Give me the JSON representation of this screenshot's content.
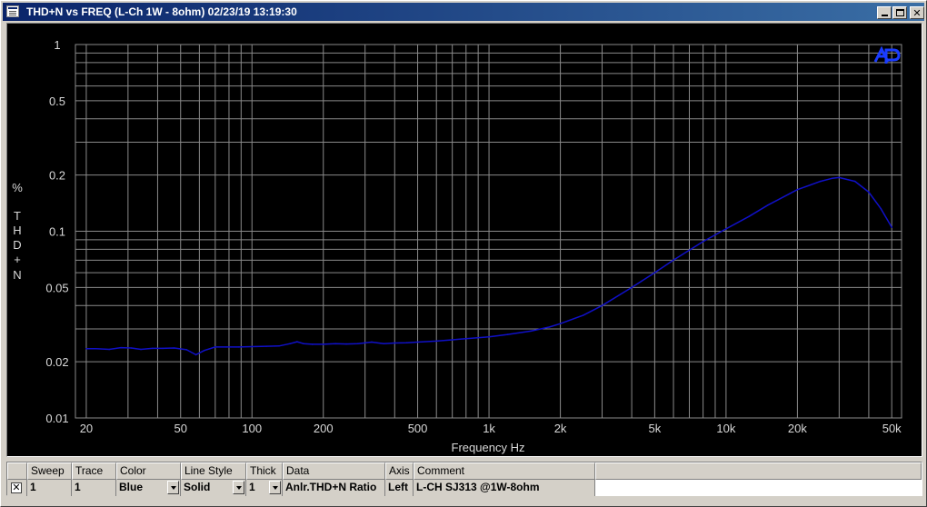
{
  "window": {
    "title": "THD+N vs FREQ (L-Ch 1W - 8ohm)  02/23/19 13:19:30"
  },
  "icons": {
    "app": "window-icon",
    "minimize": "minimize-icon",
    "maximize": "maximize-icon",
    "close": "close-icon",
    "logo": "ap-logo"
  },
  "colors": {
    "trace": "#1010c8",
    "grid": "#8a8a8a",
    "axis_text": "#d8d8d8",
    "logo": "#1a3cff"
  },
  "chart_data": {
    "type": "line",
    "title": "",
    "xlabel": "Frequency Hz",
    "ylabel": "% THD+N",
    "xscale": "log",
    "yscale": "log",
    "xlim": [
      18,
      55000
    ],
    "ylim": [
      0.01,
      1
    ],
    "grid": true,
    "x_ticks": [
      20,
      50,
      100,
      200,
      500,
      1000,
      2000,
      5000,
      10000,
      20000,
      50000
    ],
    "x_tick_labels": [
      "20",
      "50",
      "100",
      "200",
      "500",
      "1k",
      "2k",
      "5k",
      "10k",
      "20k",
      "50k"
    ],
    "y_ticks": [
      0.01,
      0.02,
      0.05,
      0.1,
      0.2,
      0.5,
      1
    ],
    "y_tick_labels": [
      "0.01",
      "0.02",
      "0.05",
      "0.1",
      "0.2",
      "0.5",
      "1"
    ],
    "series": [
      {
        "name": "L-CH SJ313 @1W-8ohm",
        "color": "Blue",
        "x": [
          20,
          22,
          25,
          28,
          31,
          34,
          38,
          42,
          47,
          53,
          58,
          63,
          70,
          78,
          88,
          100,
          115,
          130,
          145,
          155,
          165,
          180,
          200,
          225,
          250,
          280,
          320,
          360,
          400,
          450,
          500,
          600,
          700,
          800,
          1000,
          1200,
          1500,
          1800,
          2000,
          2500,
          3000,
          4000,
          5000,
          6000,
          8000,
          10000,
          12500,
          15000,
          20000,
          25000,
          28000,
          30000,
          35000,
          40000,
          45000,
          50000
        ],
        "values": [
          0.0235,
          0.0235,
          0.0233,
          0.0238,
          0.0237,
          0.0233,
          0.0236,
          0.0236,
          0.0237,
          0.0232,
          0.0218,
          0.023,
          0.024,
          0.024,
          0.024,
          0.0241,
          0.0242,
          0.0243,
          0.025,
          0.0256,
          0.025,
          0.0248,
          0.0248,
          0.025,
          0.0249,
          0.025,
          0.0255,
          0.025,
          0.0252,
          0.0253,
          0.0255,
          0.0258,
          0.0262,
          0.0266,
          0.0272,
          0.028,
          0.0292,
          0.0307,
          0.032,
          0.0355,
          0.04,
          0.05,
          0.06,
          0.07,
          0.088,
          0.103,
          0.12,
          0.138,
          0.167,
          0.185,
          0.192,
          0.194,
          0.185,
          0.162,
          0.132,
          0.105
        ]
      }
    ]
  },
  "legend_table": {
    "headers": [
      "Sweep",
      "Trace",
      "Color",
      "Line Style",
      "Thick",
      "Data",
      "Axis",
      "Comment"
    ],
    "row": {
      "checked": "✕",
      "sweep": "1",
      "trace": "1",
      "color": "Blue",
      "line_style": "Solid",
      "thick": "1",
      "data": "Anlr.THD+N Ratio",
      "axis": "Left",
      "comment": "L-CH SJ313 @1W-8ohm"
    }
  }
}
